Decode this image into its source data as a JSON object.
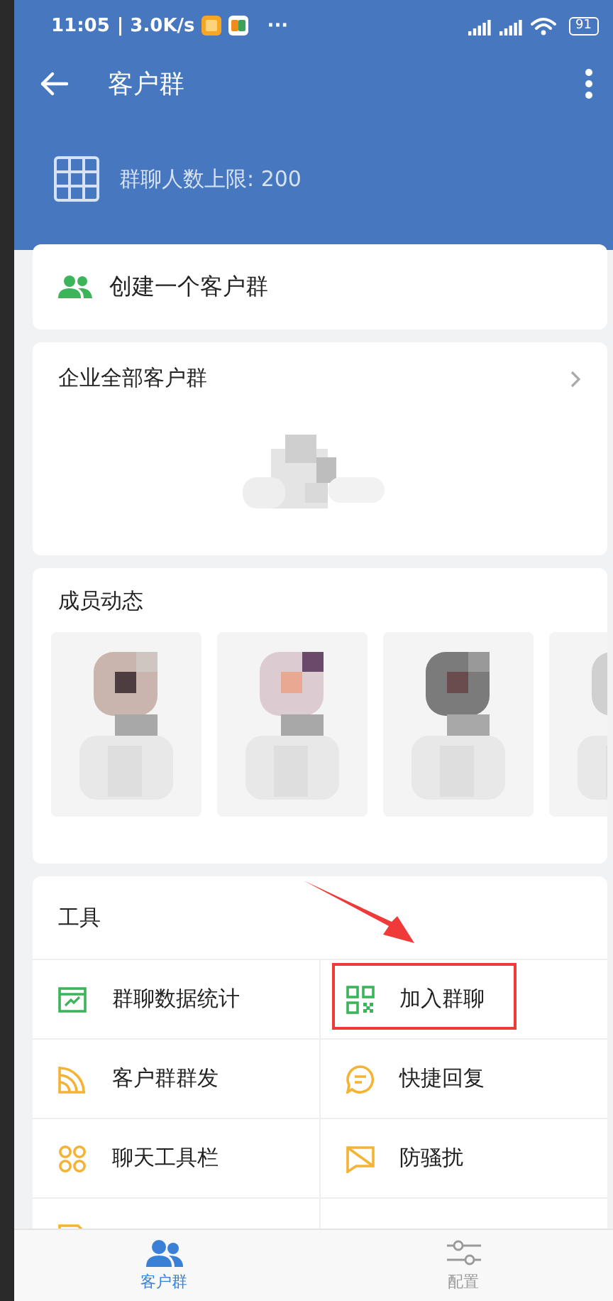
{
  "status_bar": {
    "time": "11:05",
    "speed": "| 3.0K/s",
    "more": "···",
    "battery": "91"
  },
  "app_bar": {
    "title": "客户群"
  },
  "limit": {
    "text": "群聊人数上限: 200"
  },
  "create": {
    "label": "创建一个客户群"
  },
  "all_groups": {
    "title": "企业全部客户群"
  },
  "members": {
    "title": "成员动态"
  },
  "tools": {
    "title": "工具",
    "items": [
      {
        "label": "群聊数据统计",
        "kind": "chart",
        "highlighted": false
      },
      {
        "label": "加入群聊",
        "kind": "qr",
        "highlighted": true
      },
      {
        "label": "客户群群发",
        "kind": "broadcast",
        "highlighted": false
      },
      {
        "label": "快捷回复",
        "kind": "message",
        "highlighted": false
      },
      {
        "label": "聊天工具栏",
        "kind": "flower",
        "highlighted": false
      },
      {
        "label": "防骚扰",
        "kind": "nodisturb",
        "highlighted": false
      },
      {
        "kind": "doc",
        "highlighted": false
      }
    ]
  },
  "tab_bar": [
    {
      "label": "客户群",
      "kind": "people",
      "selected": true
    },
    {
      "label": "配置",
      "kind": "sliders",
      "selected": false
    }
  ]
}
